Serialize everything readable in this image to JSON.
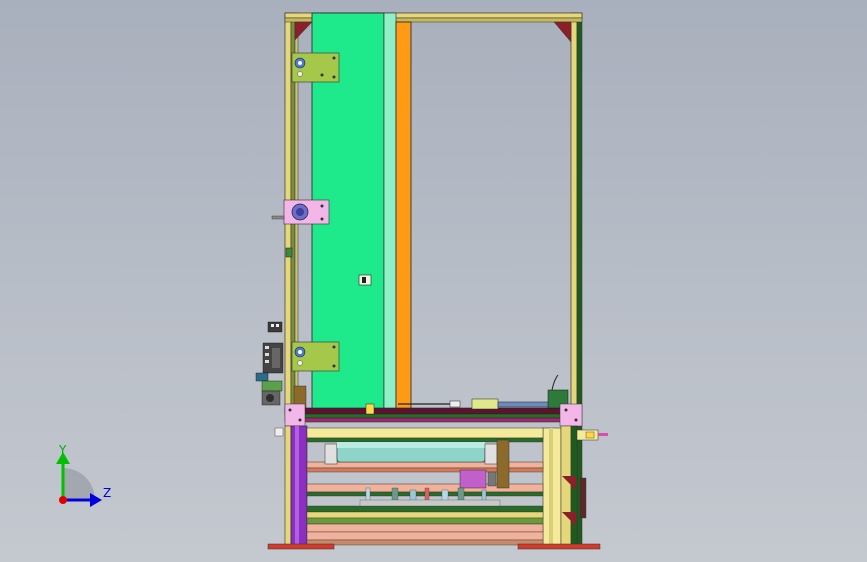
{
  "viewport": {
    "background_top": "#a9b0bd",
    "background_bottom": "#c4c8cf"
  },
  "triad": {
    "y_label": "Y",
    "z_label": "Z",
    "y_color": "#00c000",
    "z_color": "#0000e0",
    "origin_color": "#e00000"
  },
  "model_colors": {
    "green_panel": "#1eea8c",
    "orange_rail": "#ff9a14",
    "olive_plate": "#a5c84a",
    "pink_plate": "#f3b6e8",
    "purple_post": "#8a2fbf",
    "frame_yellow": "#e6d87a",
    "frame_dark_green": "#1f5a1f",
    "red_foot": "#d23a2a",
    "salmon_bar": "#f2b19a",
    "cylinder_teal": "#8fd4c8"
  }
}
